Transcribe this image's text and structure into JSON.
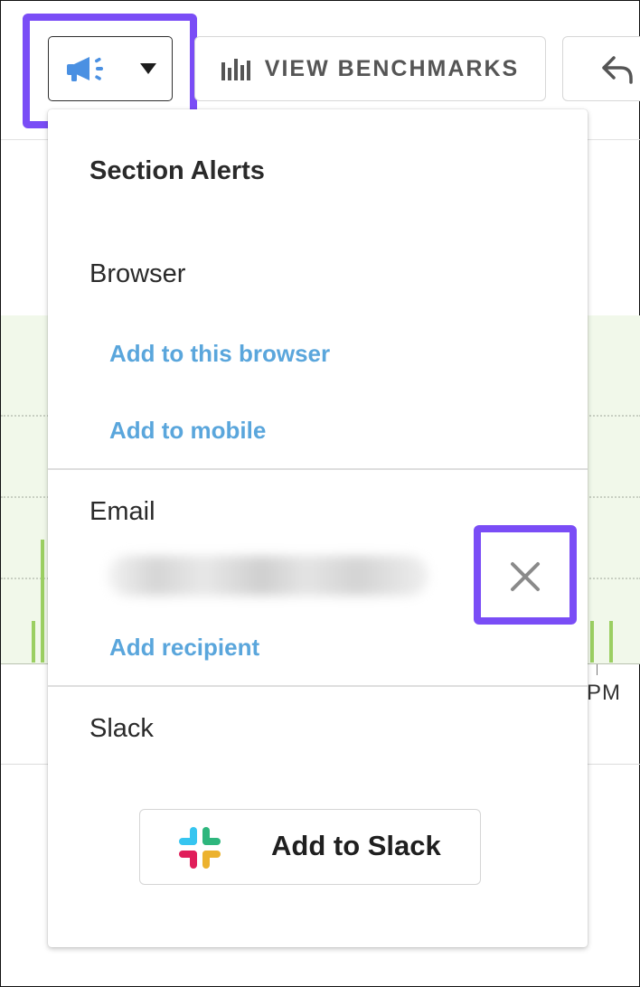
{
  "toolbar": {
    "alerts_icon": "megaphone-icon",
    "dropdown_icon": "caret-down-icon",
    "benchmarks_icon": "bar-chart-icon",
    "benchmarks_label": "VIEW BENCHMARKS",
    "share_icon": "reply-arrow-icon"
  },
  "chart": {
    "x_tick_label": "PM",
    "bar_color": "#9bcf62",
    "background_color": "#f1f8ea"
  },
  "dropdown": {
    "title": "Section Alerts",
    "browser": {
      "heading": "Browser",
      "add_browser_link": "Add to this browser",
      "add_mobile_link": "Add to mobile"
    },
    "email": {
      "heading": "Email",
      "recipient_blurred": true,
      "remove_icon": "close-icon",
      "add_recipient_link": "Add recipient"
    },
    "slack": {
      "heading": "Slack",
      "button_label": "Add to Slack",
      "logo_icon": "slack-logo-icon"
    }
  },
  "colors": {
    "highlight": "#7a4df6",
    "link": "#5aa6dc",
    "accent_icon": "#4a90e2"
  }
}
